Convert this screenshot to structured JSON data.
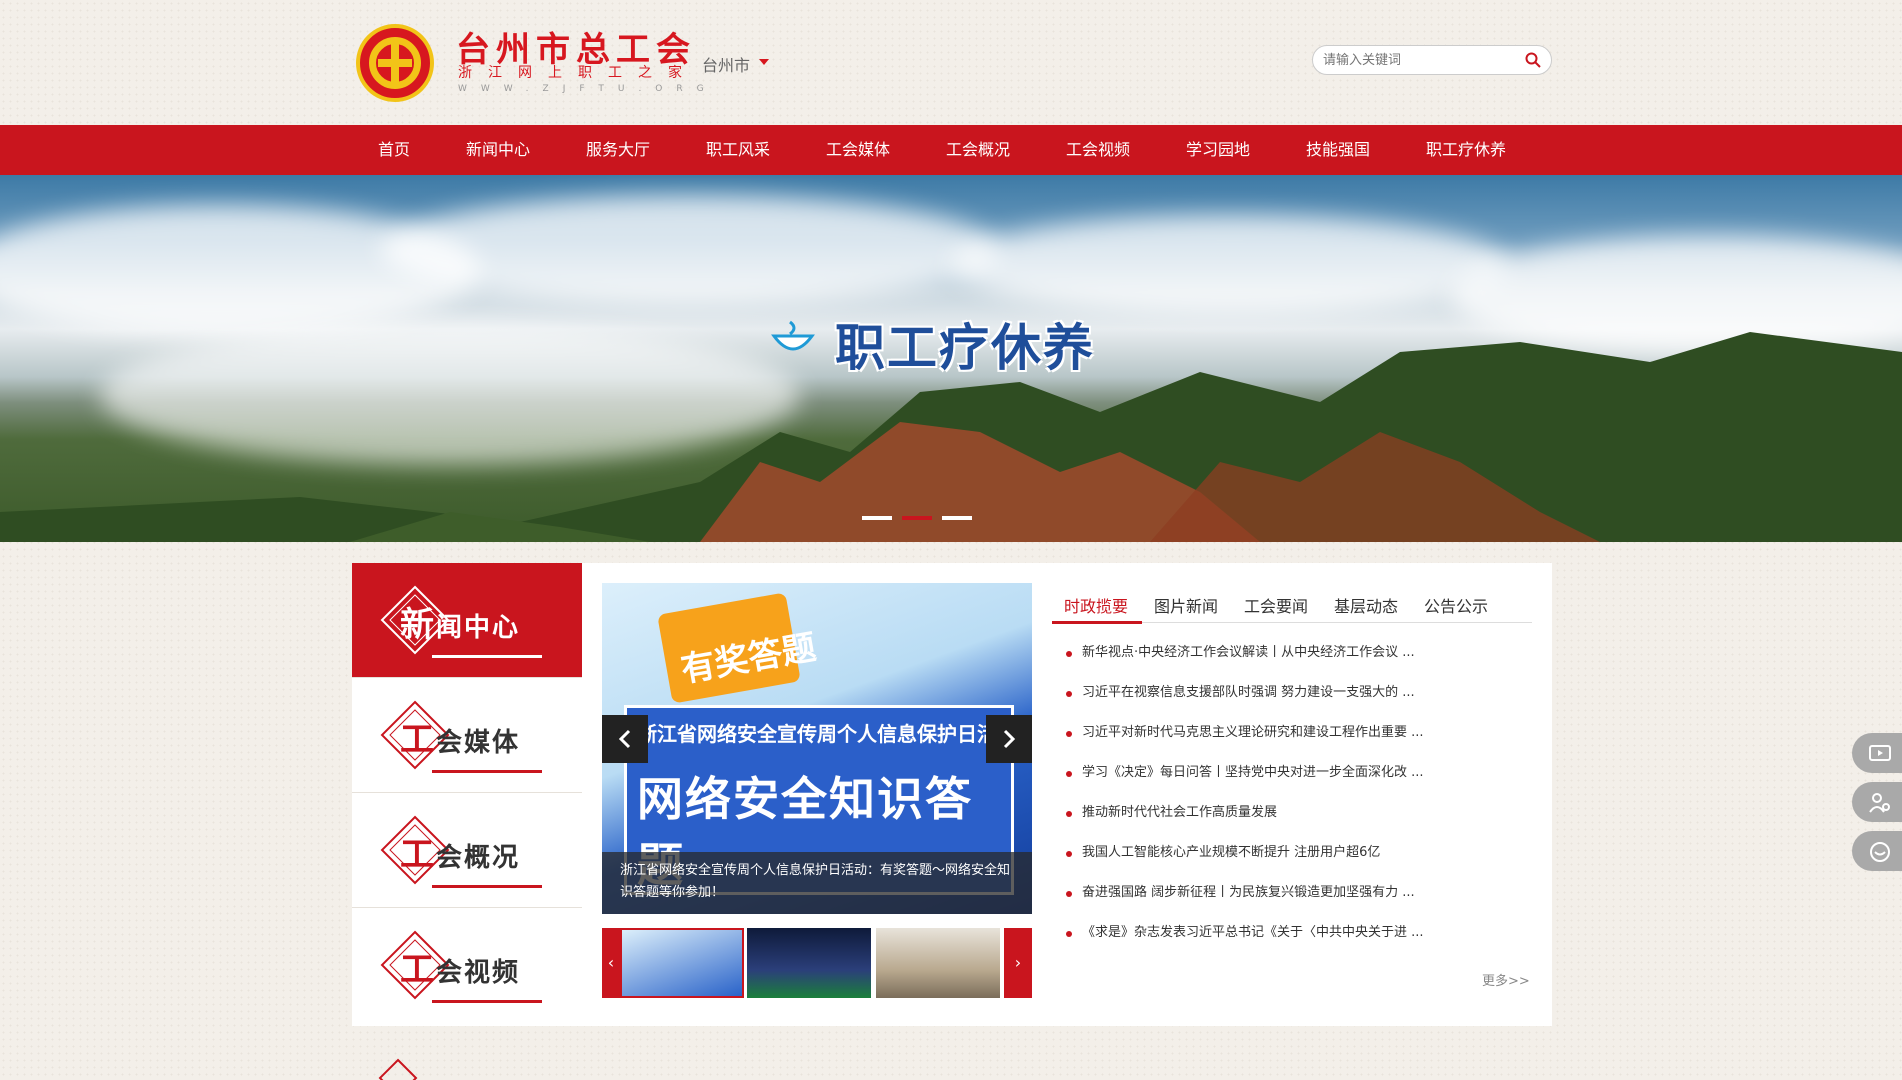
{
  "header": {
    "logo_title": "台州市总工会",
    "logo_subtitle": "浙江网上职工之家",
    "logo_url": "WWW.ZJFTU.ORG",
    "city": "台州市",
    "search_placeholder": "请输入关键词"
  },
  "nav": {
    "items": [
      {
        "label": "首页"
      },
      {
        "label": "新闻中心"
      },
      {
        "label": "服务大厅"
      },
      {
        "label": "职工风采"
      },
      {
        "label": "工会媒体"
      },
      {
        "label": "工会概况"
      },
      {
        "label": "工会视频"
      },
      {
        "label": "学习园地"
      },
      {
        "label": "技能强国"
      },
      {
        "label": "职工疗休养"
      }
    ]
  },
  "banner": {
    "title": "职工疗休养",
    "active_slide": 2,
    "slide_count": 3
  },
  "leftmenu": {
    "items": [
      {
        "first": "新",
        "rest": "闻中心"
      },
      {
        "first": "工",
        "rest": "会媒体"
      },
      {
        "first": "工",
        "rest": "会概况"
      },
      {
        "first": "工",
        "rest": "会视频"
      }
    ]
  },
  "slider": {
    "badge": "有奖答题",
    "subtitle": "浙江省网络安全宣传周个人信息保护日活动",
    "big_text": "网络安全知识答题",
    "caption": "浙江省网络安全宣传周个人信息保护日活动：有奖答题～网络安全知识答题等你参加！"
  },
  "tabs": [
    "时政揽要",
    "图片新闻",
    "工会要闻",
    "基层动态",
    "公告公示"
  ],
  "news": [
    "新华视点·中央经济工作会议解读丨从中央经济工作会议 ...",
    "习近平在视察信息支援部队时强调 努力建设一支强大的 ...",
    "习近平对新时代马克思主义理论研究和建设工程作出重要 ...",
    "学习《决定》每日问答丨坚持党中央对进一步全面深化改 ...",
    "推动新时代代社会工作高质量发展",
    "我国人工智能核心产业规模不断提升 注册用户超6亿",
    "奋进强国路 阔步新征程丨为民族复兴锻造更加坚强有力 ...",
    "《求是》杂志发表习近平总书记《关于〈中共中央关于进 ..."
  ],
  "more": "更多>>",
  "colors": {
    "brand_red": "#c9151e",
    "gold": "#f2c418"
  }
}
